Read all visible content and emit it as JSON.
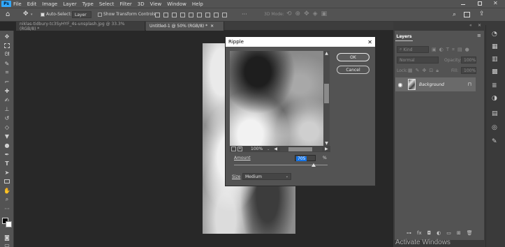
{
  "app": {
    "logo": "Ps"
  },
  "menu": [
    "File",
    "Edit",
    "Image",
    "Layer",
    "Type",
    "Select",
    "Filter",
    "3D",
    "View",
    "Window",
    "Help"
  ],
  "options": {
    "auto_select": "Auto-Select:",
    "layer_select": "Layer",
    "show_transform": "Show Transform Controls",
    "mode_3d": "3D Mode:"
  },
  "tabs": [
    {
      "label": "niklas-tidbury-tc3SyHYF_4s-unsplash.jpg @ 33.3% (RGB/8) *",
      "active": false
    },
    {
      "label": "Untitled-1 @ 50% (RGB/8) *",
      "active": true
    }
  ],
  "dialog": {
    "title": "Ripple",
    "ok": "OK",
    "cancel": "Cancel",
    "zoom": "100%",
    "amount_label": "Amount",
    "amount_value": "705",
    "amount_unit": "%",
    "amount_fraction": 0.85,
    "size_label": "Size",
    "size_value": "Medium"
  },
  "layers": {
    "tab": "Layers",
    "kind_placeholder": "Kind",
    "blend_mode": "Normal",
    "opacity_label": "Opacity:",
    "opacity_value": "100%",
    "lock_label": "Lock:",
    "fill_label": "Fill:",
    "fill_value": "100%",
    "layer_name": "Background"
  },
  "watermark": "Activate Windows",
  "colors": {
    "accent": "#31a8ff",
    "panel": "#535353",
    "workspace": "#282828"
  }
}
